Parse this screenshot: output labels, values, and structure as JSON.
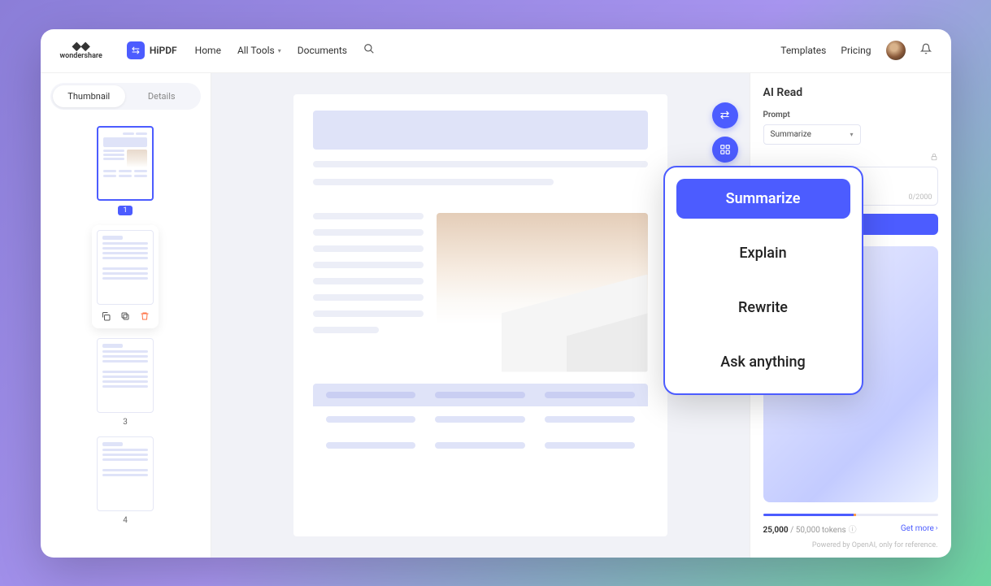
{
  "brand": {
    "wondershare": "wondershare",
    "hipdf": "HiPDF"
  },
  "nav": {
    "home": "Home",
    "all_tools": "All Tools",
    "documents": "Documents",
    "templates": "Templates",
    "pricing": "Pricing"
  },
  "left": {
    "tab_thumbnail": "Thumbnail",
    "tab_details": "Details",
    "pages": {
      "p1": "1",
      "p3": "3",
      "p4": "4"
    }
  },
  "ai": {
    "title": "AI Read",
    "prompt_label": "Prompt",
    "selected": "Summarize",
    "counter": "0/2000",
    "options": {
      "summarize": "Summarize",
      "explain": "Explain",
      "rewrite": "Rewrite",
      "ask": "Ask anything"
    }
  },
  "tokens": {
    "used": "25,000",
    "sep": " / ",
    "total": "50,000",
    "label": "tokens",
    "getmore": "Get more"
  },
  "footer": {
    "powered": "Powered by OpenAI, only for reference."
  }
}
